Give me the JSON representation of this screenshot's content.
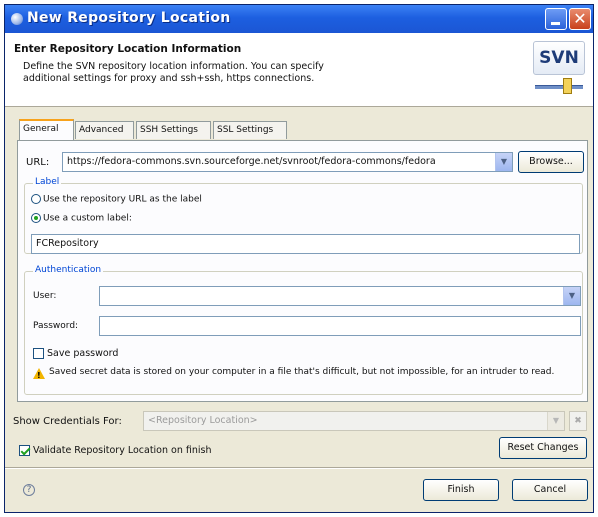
{
  "window": {
    "title": "New Repository Location"
  },
  "banner": {
    "heading": "Enter Repository Location Information",
    "description": "Define the SVN repository location information. You can specify additional settings for proxy and ssh+ssh, https connections.",
    "logo_text": "SVN"
  },
  "tabs": [
    {
      "label": "General",
      "active": true
    },
    {
      "label": "Advanced",
      "active": false
    },
    {
      "label": "SSH Settings",
      "active": false
    },
    {
      "label": "SSL Settings",
      "active": false
    }
  ],
  "url": {
    "label": "URL:",
    "value": "https://fedora-commons.svn.sourceforge.net/svnroot/fedora-commons/fedora",
    "browse_label": "Browse..."
  },
  "label_group": {
    "title": "Label",
    "option_repo_url": "Use the repository URL as the label",
    "option_custom": "Use a custom label:",
    "selected": "custom",
    "custom_value": "FCRepository"
  },
  "auth_group": {
    "title": "Authentication",
    "user_label": "User:",
    "user_value": "",
    "password_label": "Password:",
    "password_value": "",
    "save_password_label": "Save password",
    "save_password_checked": false,
    "warning_text": "Saved secret data is stored on your computer in a file that's difficult, but not impossible, for an intruder to read."
  },
  "credentials": {
    "label": "Show Credentials For:",
    "placeholder": "<Repository Location>",
    "clear_glyph": "✖"
  },
  "validate": {
    "label": "Validate Repository Location on finish",
    "checked": true
  },
  "buttons": {
    "reset": "Reset Changes",
    "finish": "Finish",
    "cancel": "Cancel",
    "help_glyph": "?"
  },
  "icons": {
    "combo_arrow": "▼",
    "close": "✕"
  },
  "colors": {
    "titlebar": "#1d5fe0",
    "group_title": "#0046d5",
    "active_tab_accent": "#f7a21c"
  }
}
